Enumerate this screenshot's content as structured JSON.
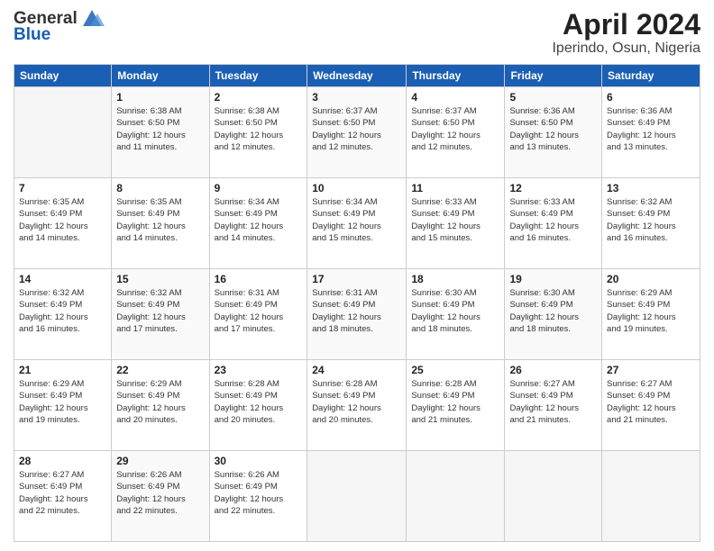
{
  "header": {
    "logo_line1": "General",
    "logo_line2": "Blue",
    "title": "April 2024",
    "subtitle": "Iperindo, Osun, Nigeria"
  },
  "calendar": {
    "days_of_week": [
      "Sunday",
      "Monday",
      "Tuesday",
      "Wednesday",
      "Thursday",
      "Friday",
      "Saturday"
    ],
    "weeks": [
      [
        {
          "day": "",
          "info": ""
        },
        {
          "day": "1",
          "info": "Sunrise: 6:38 AM\nSunset: 6:50 PM\nDaylight: 12 hours\nand 11 minutes."
        },
        {
          "day": "2",
          "info": "Sunrise: 6:38 AM\nSunset: 6:50 PM\nDaylight: 12 hours\nand 12 minutes."
        },
        {
          "day": "3",
          "info": "Sunrise: 6:37 AM\nSunset: 6:50 PM\nDaylight: 12 hours\nand 12 minutes."
        },
        {
          "day": "4",
          "info": "Sunrise: 6:37 AM\nSunset: 6:50 PM\nDaylight: 12 hours\nand 12 minutes."
        },
        {
          "day": "5",
          "info": "Sunrise: 6:36 AM\nSunset: 6:50 PM\nDaylight: 12 hours\nand 13 minutes."
        },
        {
          "day": "6",
          "info": "Sunrise: 6:36 AM\nSunset: 6:49 PM\nDaylight: 12 hours\nand 13 minutes."
        }
      ],
      [
        {
          "day": "7",
          "info": "Sunrise: 6:35 AM\nSunset: 6:49 PM\nDaylight: 12 hours\nand 14 minutes."
        },
        {
          "day": "8",
          "info": "Sunrise: 6:35 AM\nSunset: 6:49 PM\nDaylight: 12 hours\nand 14 minutes."
        },
        {
          "day": "9",
          "info": "Sunrise: 6:34 AM\nSunset: 6:49 PM\nDaylight: 12 hours\nand 14 minutes."
        },
        {
          "day": "10",
          "info": "Sunrise: 6:34 AM\nSunset: 6:49 PM\nDaylight: 12 hours\nand 15 minutes."
        },
        {
          "day": "11",
          "info": "Sunrise: 6:33 AM\nSunset: 6:49 PM\nDaylight: 12 hours\nand 15 minutes."
        },
        {
          "day": "12",
          "info": "Sunrise: 6:33 AM\nSunset: 6:49 PM\nDaylight: 12 hours\nand 16 minutes."
        },
        {
          "day": "13",
          "info": "Sunrise: 6:32 AM\nSunset: 6:49 PM\nDaylight: 12 hours\nand 16 minutes."
        }
      ],
      [
        {
          "day": "14",
          "info": "Sunrise: 6:32 AM\nSunset: 6:49 PM\nDaylight: 12 hours\nand 16 minutes."
        },
        {
          "day": "15",
          "info": "Sunrise: 6:32 AM\nSunset: 6:49 PM\nDaylight: 12 hours\nand 17 minutes."
        },
        {
          "day": "16",
          "info": "Sunrise: 6:31 AM\nSunset: 6:49 PM\nDaylight: 12 hours\nand 17 minutes."
        },
        {
          "day": "17",
          "info": "Sunrise: 6:31 AM\nSunset: 6:49 PM\nDaylight: 12 hours\nand 18 minutes."
        },
        {
          "day": "18",
          "info": "Sunrise: 6:30 AM\nSunset: 6:49 PM\nDaylight: 12 hours\nand 18 minutes."
        },
        {
          "day": "19",
          "info": "Sunrise: 6:30 AM\nSunset: 6:49 PM\nDaylight: 12 hours\nand 18 minutes."
        },
        {
          "day": "20",
          "info": "Sunrise: 6:29 AM\nSunset: 6:49 PM\nDaylight: 12 hours\nand 19 minutes."
        }
      ],
      [
        {
          "day": "21",
          "info": "Sunrise: 6:29 AM\nSunset: 6:49 PM\nDaylight: 12 hours\nand 19 minutes."
        },
        {
          "day": "22",
          "info": "Sunrise: 6:29 AM\nSunset: 6:49 PM\nDaylight: 12 hours\nand 20 minutes."
        },
        {
          "day": "23",
          "info": "Sunrise: 6:28 AM\nSunset: 6:49 PM\nDaylight: 12 hours\nand 20 minutes."
        },
        {
          "day": "24",
          "info": "Sunrise: 6:28 AM\nSunset: 6:49 PM\nDaylight: 12 hours\nand 20 minutes."
        },
        {
          "day": "25",
          "info": "Sunrise: 6:28 AM\nSunset: 6:49 PM\nDaylight: 12 hours\nand 21 minutes."
        },
        {
          "day": "26",
          "info": "Sunrise: 6:27 AM\nSunset: 6:49 PM\nDaylight: 12 hours\nand 21 minutes."
        },
        {
          "day": "27",
          "info": "Sunrise: 6:27 AM\nSunset: 6:49 PM\nDaylight: 12 hours\nand 21 minutes."
        }
      ],
      [
        {
          "day": "28",
          "info": "Sunrise: 6:27 AM\nSunset: 6:49 PM\nDaylight: 12 hours\nand 22 minutes."
        },
        {
          "day": "29",
          "info": "Sunrise: 6:26 AM\nSunset: 6:49 PM\nDaylight: 12 hours\nand 22 minutes."
        },
        {
          "day": "30",
          "info": "Sunrise: 6:26 AM\nSunset: 6:49 PM\nDaylight: 12 hours\nand 22 minutes."
        },
        {
          "day": "",
          "info": ""
        },
        {
          "day": "",
          "info": ""
        },
        {
          "day": "",
          "info": ""
        },
        {
          "day": "",
          "info": ""
        }
      ]
    ]
  }
}
